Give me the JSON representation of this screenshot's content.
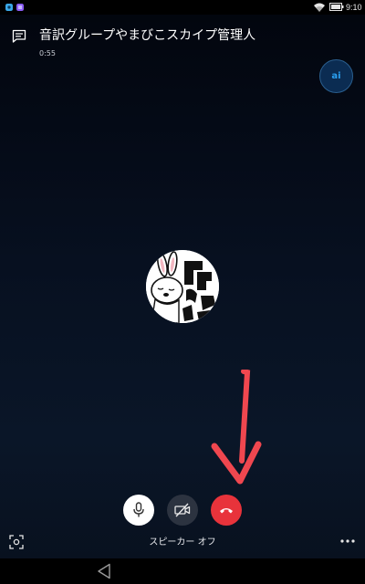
{
  "status_bar": {
    "time": "9:10",
    "notification_icons": [
      "app-notification-icon",
      "app-notification-icon"
    ],
    "colors": {
      "notif1": "#3aa8e8",
      "notif2": "#8b5cf6"
    }
  },
  "header": {
    "chat_icon": "chat-icon",
    "title": "音訳グループやまびこスカイプ管理人",
    "duration": "0:55",
    "self_avatar_initials": "ai"
  },
  "caller": {
    "avatar": "rabbit-avatar-image"
  },
  "controls": {
    "mute_icon": "microphone-icon",
    "video_icon": "video-off-icon",
    "end_icon": "hang-up-icon",
    "speaker_label": "スピーカー オフ",
    "screenshot_icon": "screenshot-icon",
    "more_icon": "more-icon"
  },
  "annotation": {
    "arrow_color": "#f0474f"
  },
  "colors": {
    "end_call": "#e8333b",
    "accent": "#2a9ff0",
    "background_dark": "#071020"
  }
}
